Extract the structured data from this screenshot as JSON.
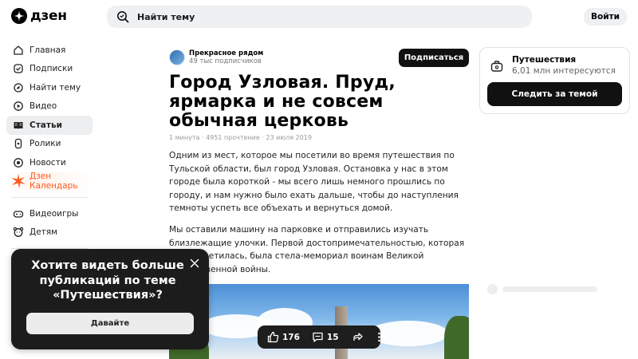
{
  "header": {
    "logo_text": "дзен",
    "search_placeholder": "Найти тему",
    "login_label": "Войти"
  },
  "sidebar": {
    "items": [
      {
        "label": "Главная",
        "icon": "home-icon"
      },
      {
        "label": "Подписки",
        "icon": "subscriptions-icon"
      },
      {
        "label": "Найти тему",
        "icon": "compass-icon"
      },
      {
        "label": "Видео",
        "icon": "video-icon"
      },
      {
        "label": "Статьи",
        "icon": "book-icon",
        "active": true
      },
      {
        "label": "Ролики",
        "icon": "shorts-icon"
      },
      {
        "label": "Новости",
        "icon": "news-icon"
      },
      {
        "label": "Дзен Календарь",
        "icon": "burst-icon"
      }
    ],
    "secondary": [
      {
        "label": "Видеоигры",
        "icon": "gamepad-icon"
      },
      {
        "label": "Детям",
        "icon": "kids-icon"
      }
    ]
  },
  "article": {
    "author_name": "Прекрасное рядом",
    "author_subs": "49 тыс подписчиков",
    "subscribe_label": "Подписаться",
    "title": "Город Узловая. Пруд, ярмарка и не совсем обычная церковь",
    "meta": "1 минута · 4951 прочтение · 23 июля 2019",
    "paragraphs": [
      "Одним из мест, которое мы посетили во время путешествия по Тульской области, был город Узловая. Остановка у нас в этом городе была короткой - мы всего лишь немного прошлись по городу, и нам нужно было ехать дальше, чтобы до наступления темноты успеть все объехать и вернуться домой.",
      "Мы оставили машину на парковке и отправились изучать близлежащие улочки. Первой достопримечательностью, которая нам встретилась, была стела-мемориал воинам Великой Отечественной войны."
    ]
  },
  "topic": {
    "name": "Путешествия",
    "count": "6,01 млн интересуются",
    "follow_label": "Следить за темой"
  },
  "popup": {
    "text": "Хотите видеть больше публикаций по теме «Путешествия»?",
    "button_label": "Давайте"
  },
  "actions": {
    "likes": "176",
    "comments": "15"
  },
  "colors": {
    "accent": "#ff5a1f",
    "dark": "#111111"
  }
}
